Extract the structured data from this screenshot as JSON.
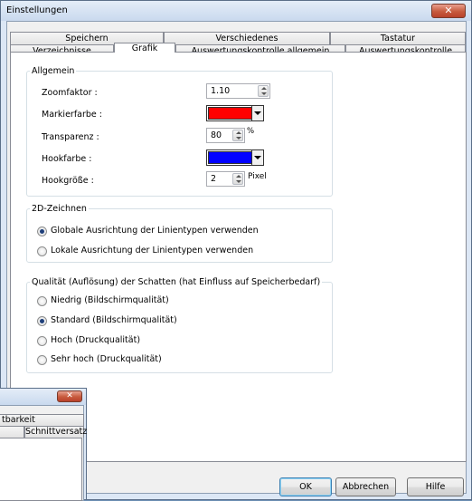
{
  "window": {
    "title": "Einstellungen",
    "close_label": "✕"
  },
  "tabs_row1": [
    "Speichern",
    "Verschiedenes",
    "Tastatur"
  ],
  "tabs_row2": [
    "Verzeichnisse",
    "Grafik",
    "Auswertungskontrolle allgemein",
    "Auswertungskontrolle"
  ],
  "selected_tab": "Grafik",
  "allgemein": {
    "legend": "Allgemein",
    "zoom_label": "Zoomfaktor :",
    "zoom_value": "1.10",
    "markier_label": "Markierfarbe :",
    "markier_color": "#ff0000",
    "transparenz_label": "Transparenz :",
    "transparenz_value": "80",
    "transparenz_unit": "%",
    "hook_label": "Hookfarbe :",
    "hook_color": "#0000ff",
    "hookgroesse_label": "Hookgröße :",
    "hookgroesse_value": "2",
    "hookgroesse_unit": "Pixel"
  },
  "zeichnen": {
    "legend": "2D-Zeichnen",
    "options": [
      {
        "label": "Globale Ausrichtung der Linientypen verwenden",
        "selected": true
      },
      {
        "label": "Lokale Ausrichtung der Linientypen verwenden",
        "selected": false
      }
    ]
  },
  "schatten": {
    "legend": "Qualität (Auflösung) der Schatten (hat Einfluss auf Speicherbedarf)",
    "options": [
      {
        "label": "Niedrig (Bildschirmqualität)",
        "selected": false
      },
      {
        "label": "Standard (Bildschirmqualität)",
        "selected": true
      },
      {
        "label": "Hoch (Druckqualität)",
        "selected": false
      },
      {
        "label": "Sehr hoch (Druckqualität)",
        "selected": false
      }
    ]
  },
  "buttons": {
    "ok": "OK",
    "cancel": "Abbrechen",
    "help": "Hilfe"
  },
  "bg_window": {
    "close_label": "✕",
    "tab_partial": "tbarkeit",
    "tab_schnitt": "Schnittversatz"
  }
}
